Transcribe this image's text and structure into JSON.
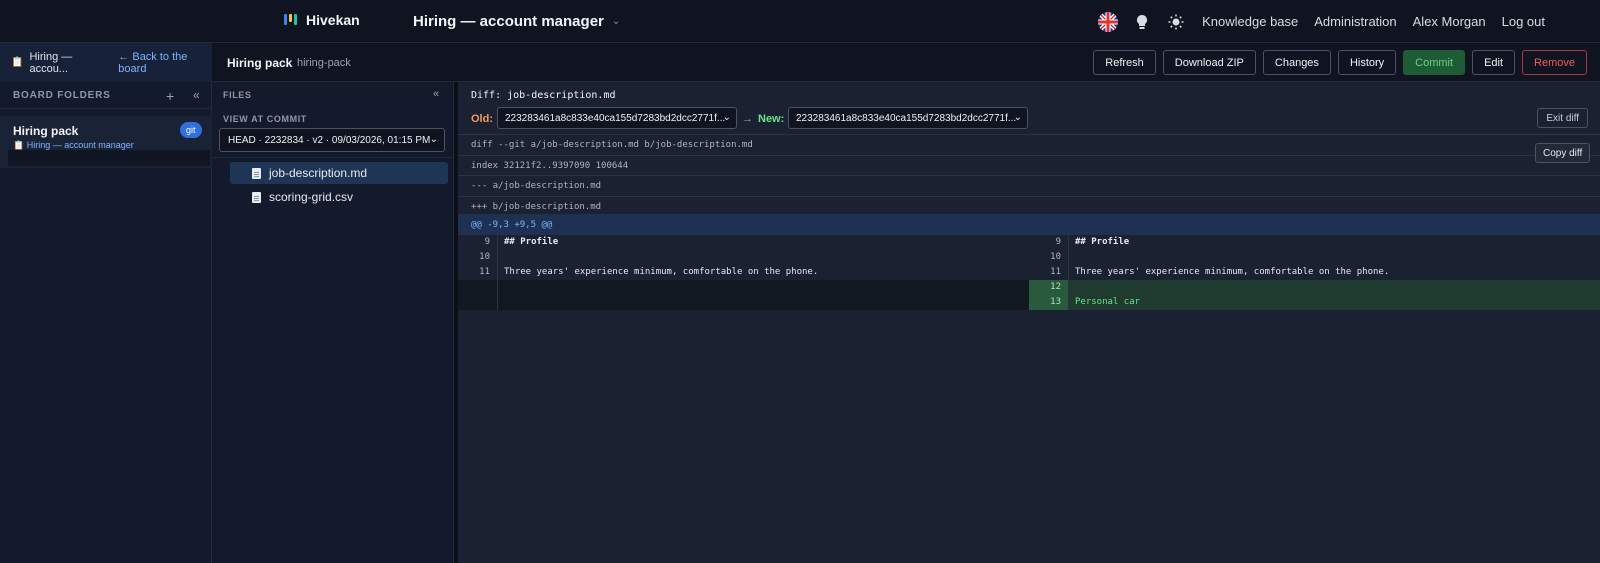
{
  "app": {
    "name": "Hivekan",
    "board_title": "Hiring — account manager"
  },
  "topnav": {
    "links": [
      "Knowledge base",
      "Administration",
      "Alex Morgan",
      "Log out"
    ]
  },
  "subheader": {
    "crumb_board": "Hiring — accou...",
    "back": "← Back to the board",
    "pack_title": "Hiring pack",
    "pack_slug": "hiring-pack",
    "actions": [
      "Refresh",
      "Download ZIP",
      "Changes",
      "History",
      "Commit",
      "Edit",
      "Remove"
    ]
  },
  "sidebar": {
    "heading": "BOARD FOLDERS",
    "item": {
      "name": "Hiring pack",
      "sub": "Hiring — account manager",
      "badge": "git"
    }
  },
  "files": {
    "heading": "FILES",
    "view_label": "VIEW AT COMMIT",
    "commit_select": "HEAD · 2232834 · v2 · 09/03/2026, 01:15 PM",
    "items": [
      "job-description.md",
      "scoring-grid.csv"
    ]
  },
  "diff": {
    "title": "Diff: job-description.md",
    "old_label": "Old:",
    "new_label": "New:",
    "arrow": "→",
    "old_hash": "223283461a8c833e40ca155d7283bd2dcc2771f...",
    "new_hash": "223283461a8c833e40ca155d7283bd2dcc2771f...",
    "exit": "Exit diff",
    "copy": "Copy diff",
    "meta": [
      "diff --git a/job-description.md b/job-description.md",
      "index 32121f2..9397090 100644",
      "--- a/job-description.md",
      "+++ b/job-description.md"
    ],
    "hunk": "@@ -9,3 +9,5 @@",
    "left": [
      {
        "num": "9",
        "text": "## Profile"
      },
      {
        "num": "10",
        "text": ""
      },
      {
        "num": "11",
        "text": "Three years' experience minimum, comfortable on the phone."
      }
    ],
    "right": [
      {
        "num": "9",
        "text": "## Profile"
      },
      {
        "num": "10",
        "text": ""
      },
      {
        "num": "11",
        "text": "Three years' experience minimum, comfortable on the phone."
      },
      {
        "num": "12",
        "text": ""
      },
      {
        "num": "13",
        "text": "Personal car"
      }
    ]
  }
}
